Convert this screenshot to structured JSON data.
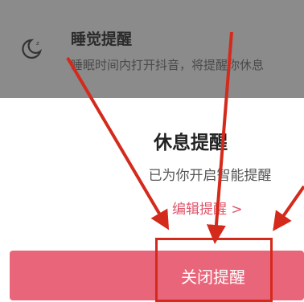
{
  "sleep_reminder": {
    "title": "睡觉提醒",
    "description": "睡眠时间内打开抖音，将提醒你休息",
    "icon": "moon-icon"
  },
  "rest_reminder": {
    "title": "休息提醒",
    "subtitle": "已为你开启智能提醒",
    "edit_link": "编辑提醒 >"
  },
  "close_button": {
    "label": "关闭提醒"
  },
  "colors": {
    "overlay": "#8b8b8b",
    "accent": "#e9657a",
    "annotation": "#d42a1c"
  }
}
